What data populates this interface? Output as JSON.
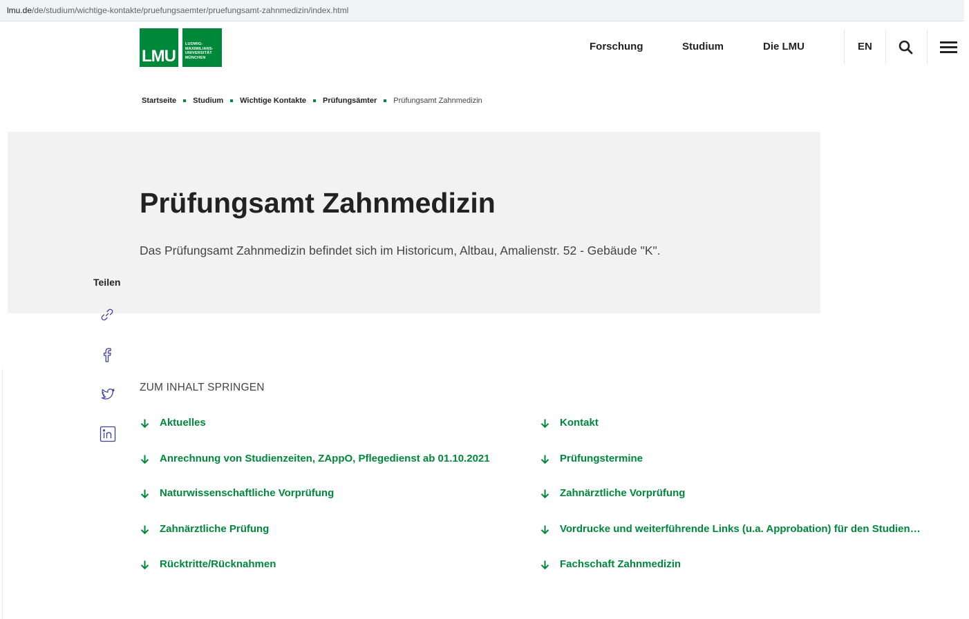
{
  "browser": {
    "url_host": "lmu.de",
    "url_path": "/de/studium/wichtige-kontakte/pruefungsaemter/pruefungsamt-zahnmedizin/index.html"
  },
  "header": {
    "logo_text": "LMU",
    "logo_subtext": "LUDWIG-MAXIMILIANS-UNIVERSITÄT MÜNCHEN",
    "nav": [
      "Forschung",
      "Studium",
      "Die LMU"
    ],
    "lang": "EN",
    "icons": [
      "search-icon",
      "menu-icon"
    ]
  },
  "breadcrumb": [
    "Startseite",
    "Studium",
    "Wichtige Kontakte",
    "Prüfungsämter"
  ],
  "breadcrumb_current": "Prüfungsamt Zahnmedizin",
  "hero": {
    "title": "Prüfungsamt Zahnmedizin",
    "intro": "Das Prüfungsamt Zahnmedizin befindet sich im Historicum, Altbau, Amalienstr. 52 - Gebäude \"K\"."
  },
  "share": {
    "label": "Teilen",
    "icons": [
      "link-icon",
      "facebook-icon",
      "twitter-icon",
      "linkedin-icon"
    ]
  },
  "jump": {
    "title": "ZUM INHALT SPRINGEN",
    "left": [
      "Aktuelles",
      "Anrechnung von Studienzeiten, ZAppO, Pflegedienst ab 01.10.2021",
      "Naturwissenschaftliche Vorprüfung",
      "Zahnärztliche Prüfung",
      "Rücktritte/Rücknahmen"
    ],
    "right": [
      "Kontakt",
      "Prüfungstermine",
      "Zahnärztliche Vorprüfung",
      "Vordrucke und weiterführende Links (u.a. Approbation) für den Studien…",
      "Fachschaft Zahnmedizin"
    ]
  },
  "colors": {
    "accent": "#00883a",
    "hero_bg": "#f2f2f2",
    "share_icon": "#3b3fa0"
  }
}
